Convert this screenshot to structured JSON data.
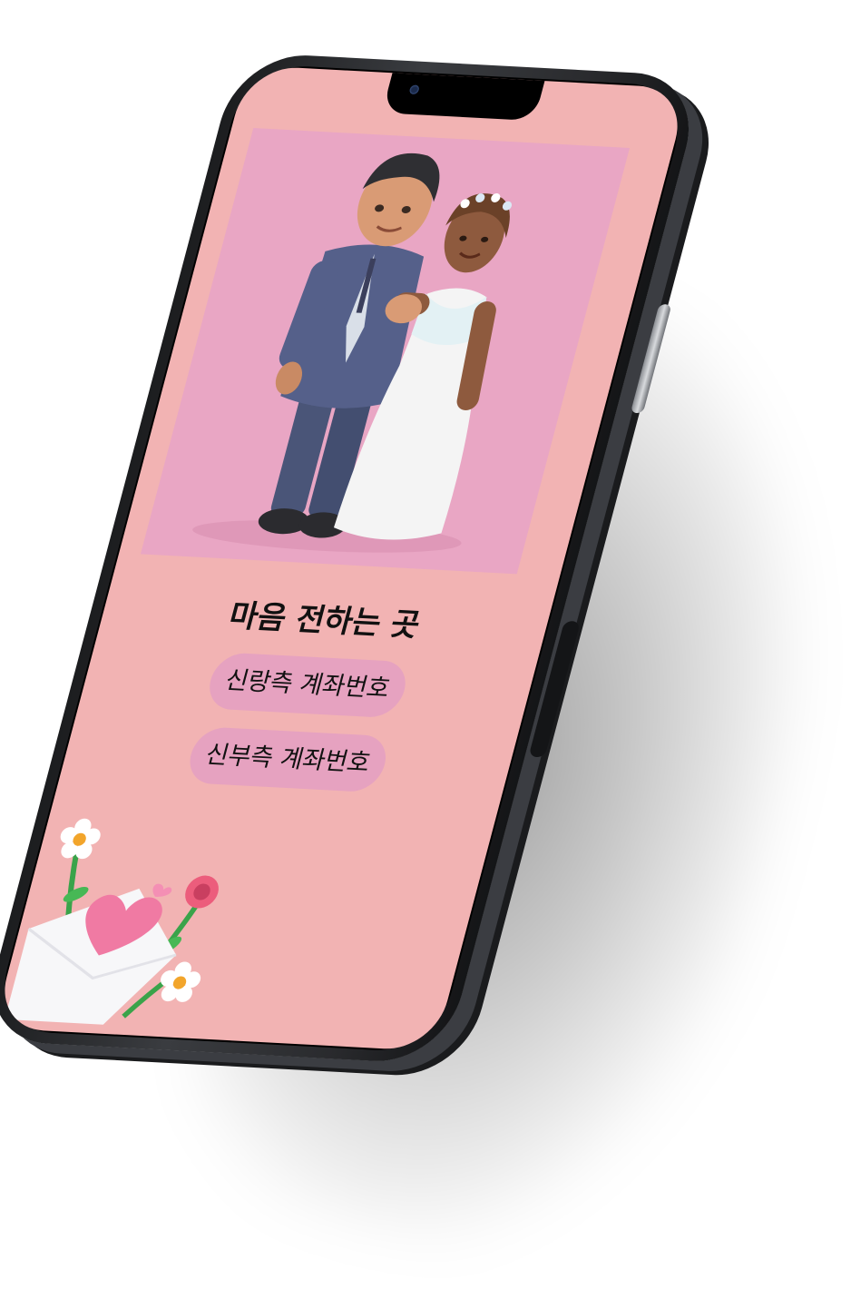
{
  "gift_section": {
    "title": "마음 전하는 곳",
    "groom_account_label": "신랑측 계좌번호",
    "bride_account_label": "신부측 계좌번호"
  },
  "images": {
    "hero": "wedding-couple-3d-figure",
    "decoration": "love-letter-envelope-with-flowers"
  },
  "colors": {
    "screen_background": "#f2b3b3",
    "hero_background": "#e9a6c4",
    "button_background": "#e6a2c0",
    "text": "#111111"
  }
}
